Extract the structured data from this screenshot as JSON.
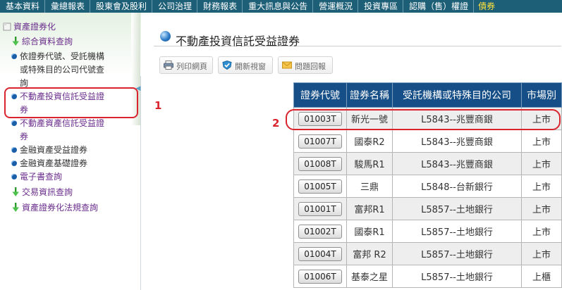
{
  "topnav": {
    "items": [
      "基本資料",
      "彙總報表",
      "股東會及股利",
      "公司治理",
      "財務報表",
      "重大訊息與公告",
      "營運概況",
      "投資專區",
      "認購（售）權證"
    ],
    "last": "債券"
  },
  "sidebar": {
    "root": "資產證券化",
    "summary": "綜合資料查詢",
    "by_code": "依證券代號、受託機構或特殊目的公司代號查詢",
    "reits": "不動產投資信託受益證券",
    "reats": "不動產資產信託受益證券",
    "fabs": "金融資產受益證券",
    "fabs_basic": "金融資產基礎證券",
    "ebook": "電子書查詢",
    "trading": "交易資訊查詢",
    "regulations": "資產證券化法規查詢"
  },
  "annotations": {
    "marker1": "1",
    "marker2": "2"
  },
  "main": {
    "title": "不動產投資信託受益證券",
    "buttons": {
      "print": "列印網頁",
      "new_window": "開新視窗",
      "feedback": "問題回報"
    }
  },
  "table": {
    "headers": [
      "證券代號",
      "證券名稱",
      "受託機構或特殊目的公司",
      "市場別"
    ],
    "rows": [
      [
        "01003T",
        "新光一號",
        "L5843--兆豐商銀",
        "上市"
      ],
      [
        "01007T",
        "國泰R2",
        "L5843--兆豐商銀",
        "上市"
      ],
      [
        "01008T",
        "駿馬R1",
        "L5843--兆豐商銀",
        "上市"
      ],
      [
        "01005T",
        "三鼎",
        "L5848--台新銀行",
        "上市"
      ],
      [
        "01001T",
        "富邦R1",
        "L5857--土地銀行",
        "上市"
      ],
      [
        "01002T",
        "國泰R1",
        "L5857--土地銀行",
        "上市"
      ],
      [
        "01004T",
        "富邦 R2",
        "L5857--土地銀行",
        "上市"
      ],
      [
        "01006T",
        "基泰之星",
        "L5857--土地銀行",
        "上櫃"
      ]
    ]
  },
  "colors": {
    "nav_bg": "#1d5f77",
    "table_header": "#164f87",
    "highlight": "#d9232d",
    "link_purple": "#6a2d8c"
  }
}
